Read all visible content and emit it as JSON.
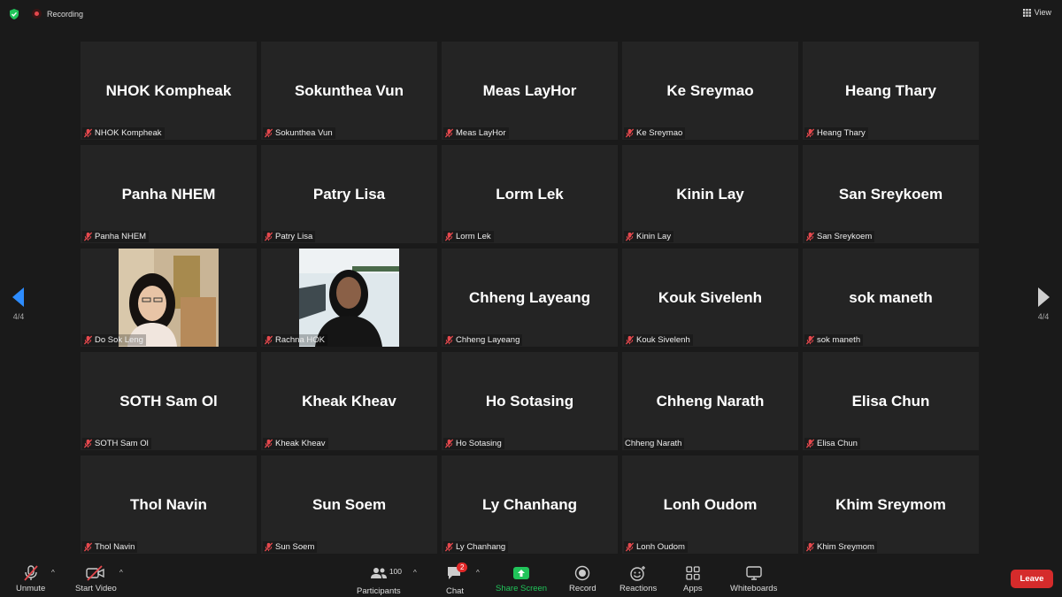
{
  "header": {
    "recording_label": "Recording",
    "view_label": "View"
  },
  "nav": {
    "page_indicator": "4/4"
  },
  "participants": [
    {
      "display": "NHOK Kompheak",
      "label": "NHOK Kompheak",
      "muted": true,
      "video": false
    },
    {
      "display": "Sokunthea Vun",
      "label": "Sokunthea Vun",
      "muted": true,
      "video": false
    },
    {
      "display": "Meas LayHor",
      "label": "Meas LayHor",
      "muted": true,
      "video": false
    },
    {
      "display": "Ke Sreymao",
      "label": "Ke Sreymao",
      "muted": true,
      "video": false
    },
    {
      "display": "Heang Thary",
      "label": "Heang Thary",
      "muted": true,
      "video": false
    },
    {
      "display": "Panha NHEM",
      "label": "Panha NHEM",
      "muted": true,
      "video": false
    },
    {
      "display": "Patry Lisa",
      "label": "Patry Lisa",
      "muted": true,
      "video": false
    },
    {
      "display": "Lorm Lek",
      "label": "Lorm Lek",
      "muted": true,
      "video": false
    },
    {
      "display": "Kinin Lay",
      "label": "Kinin Lay",
      "muted": true,
      "video": false
    },
    {
      "display": "San Sreykoem",
      "label": "San Sreykoem",
      "muted": true,
      "video": false
    },
    {
      "display": "",
      "label": "Do Sok Leng",
      "muted": true,
      "video": true,
      "photo": "a"
    },
    {
      "display": "",
      "label": "Rachna HOK",
      "muted": true,
      "video": true,
      "photo": "b"
    },
    {
      "display": "Chheng Layeang",
      "label": "Chheng Layeang",
      "muted": true,
      "video": false
    },
    {
      "display": "Kouk Sivelenh",
      "label": "Kouk Sivelenh",
      "muted": true,
      "video": false
    },
    {
      "display": "sok maneth",
      "label": "sok maneth",
      "muted": true,
      "video": false
    },
    {
      "display": "SOTH Sam Ol",
      "label": "SOTH Sam Ol",
      "muted": true,
      "video": false
    },
    {
      "display": "Kheak Kheav",
      "label": "Kheak Kheav",
      "muted": true,
      "video": false
    },
    {
      "display": "Ho Sotasing",
      "label": "Ho Sotasing",
      "muted": true,
      "video": false
    },
    {
      "display": "Chheng Narath",
      "label": "Chheng Narath",
      "muted": false,
      "video": false
    },
    {
      "display": "Elisa Chun",
      "label": "Elisa Chun",
      "muted": true,
      "video": false
    },
    {
      "display": "Thol Navin",
      "label": "Thol Navin",
      "muted": true,
      "video": false
    },
    {
      "display": "Sun Soem",
      "label": "Sun Soem",
      "muted": true,
      "video": false
    },
    {
      "display": "Ly Chanhang",
      "label": "Ly Chanhang",
      "muted": true,
      "video": false
    },
    {
      "display": "Lonh Oudom",
      "label": "Lonh Oudom",
      "muted": true,
      "video": false
    },
    {
      "display": "Khim Sreymom",
      "label": "Khim Sreymom",
      "muted": true,
      "video": false
    }
  ],
  "toolbar": {
    "unmute": "Unmute",
    "start_video": "Start Video",
    "participants": "Participants",
    "participants_count": "100",
    "chat": "Chat",
    "chat_badge": "2",
    "share_screen": "Share Screen",
    "record": "Record",
    "reactions": "Reactions",
    "apps": "Apps",
    "whiteboards": "Whiteboards",
    "leave": "Leave"
  },
  "colors": {
    "background": "#1a1a1a",
    "tile": "#242424",
    "accent_blue": "#2d8cff",
    "share_green": "#21c45a",
    "leave_red": "#d52b2b",
    "muted_red": "#e5484d"
  }
}
